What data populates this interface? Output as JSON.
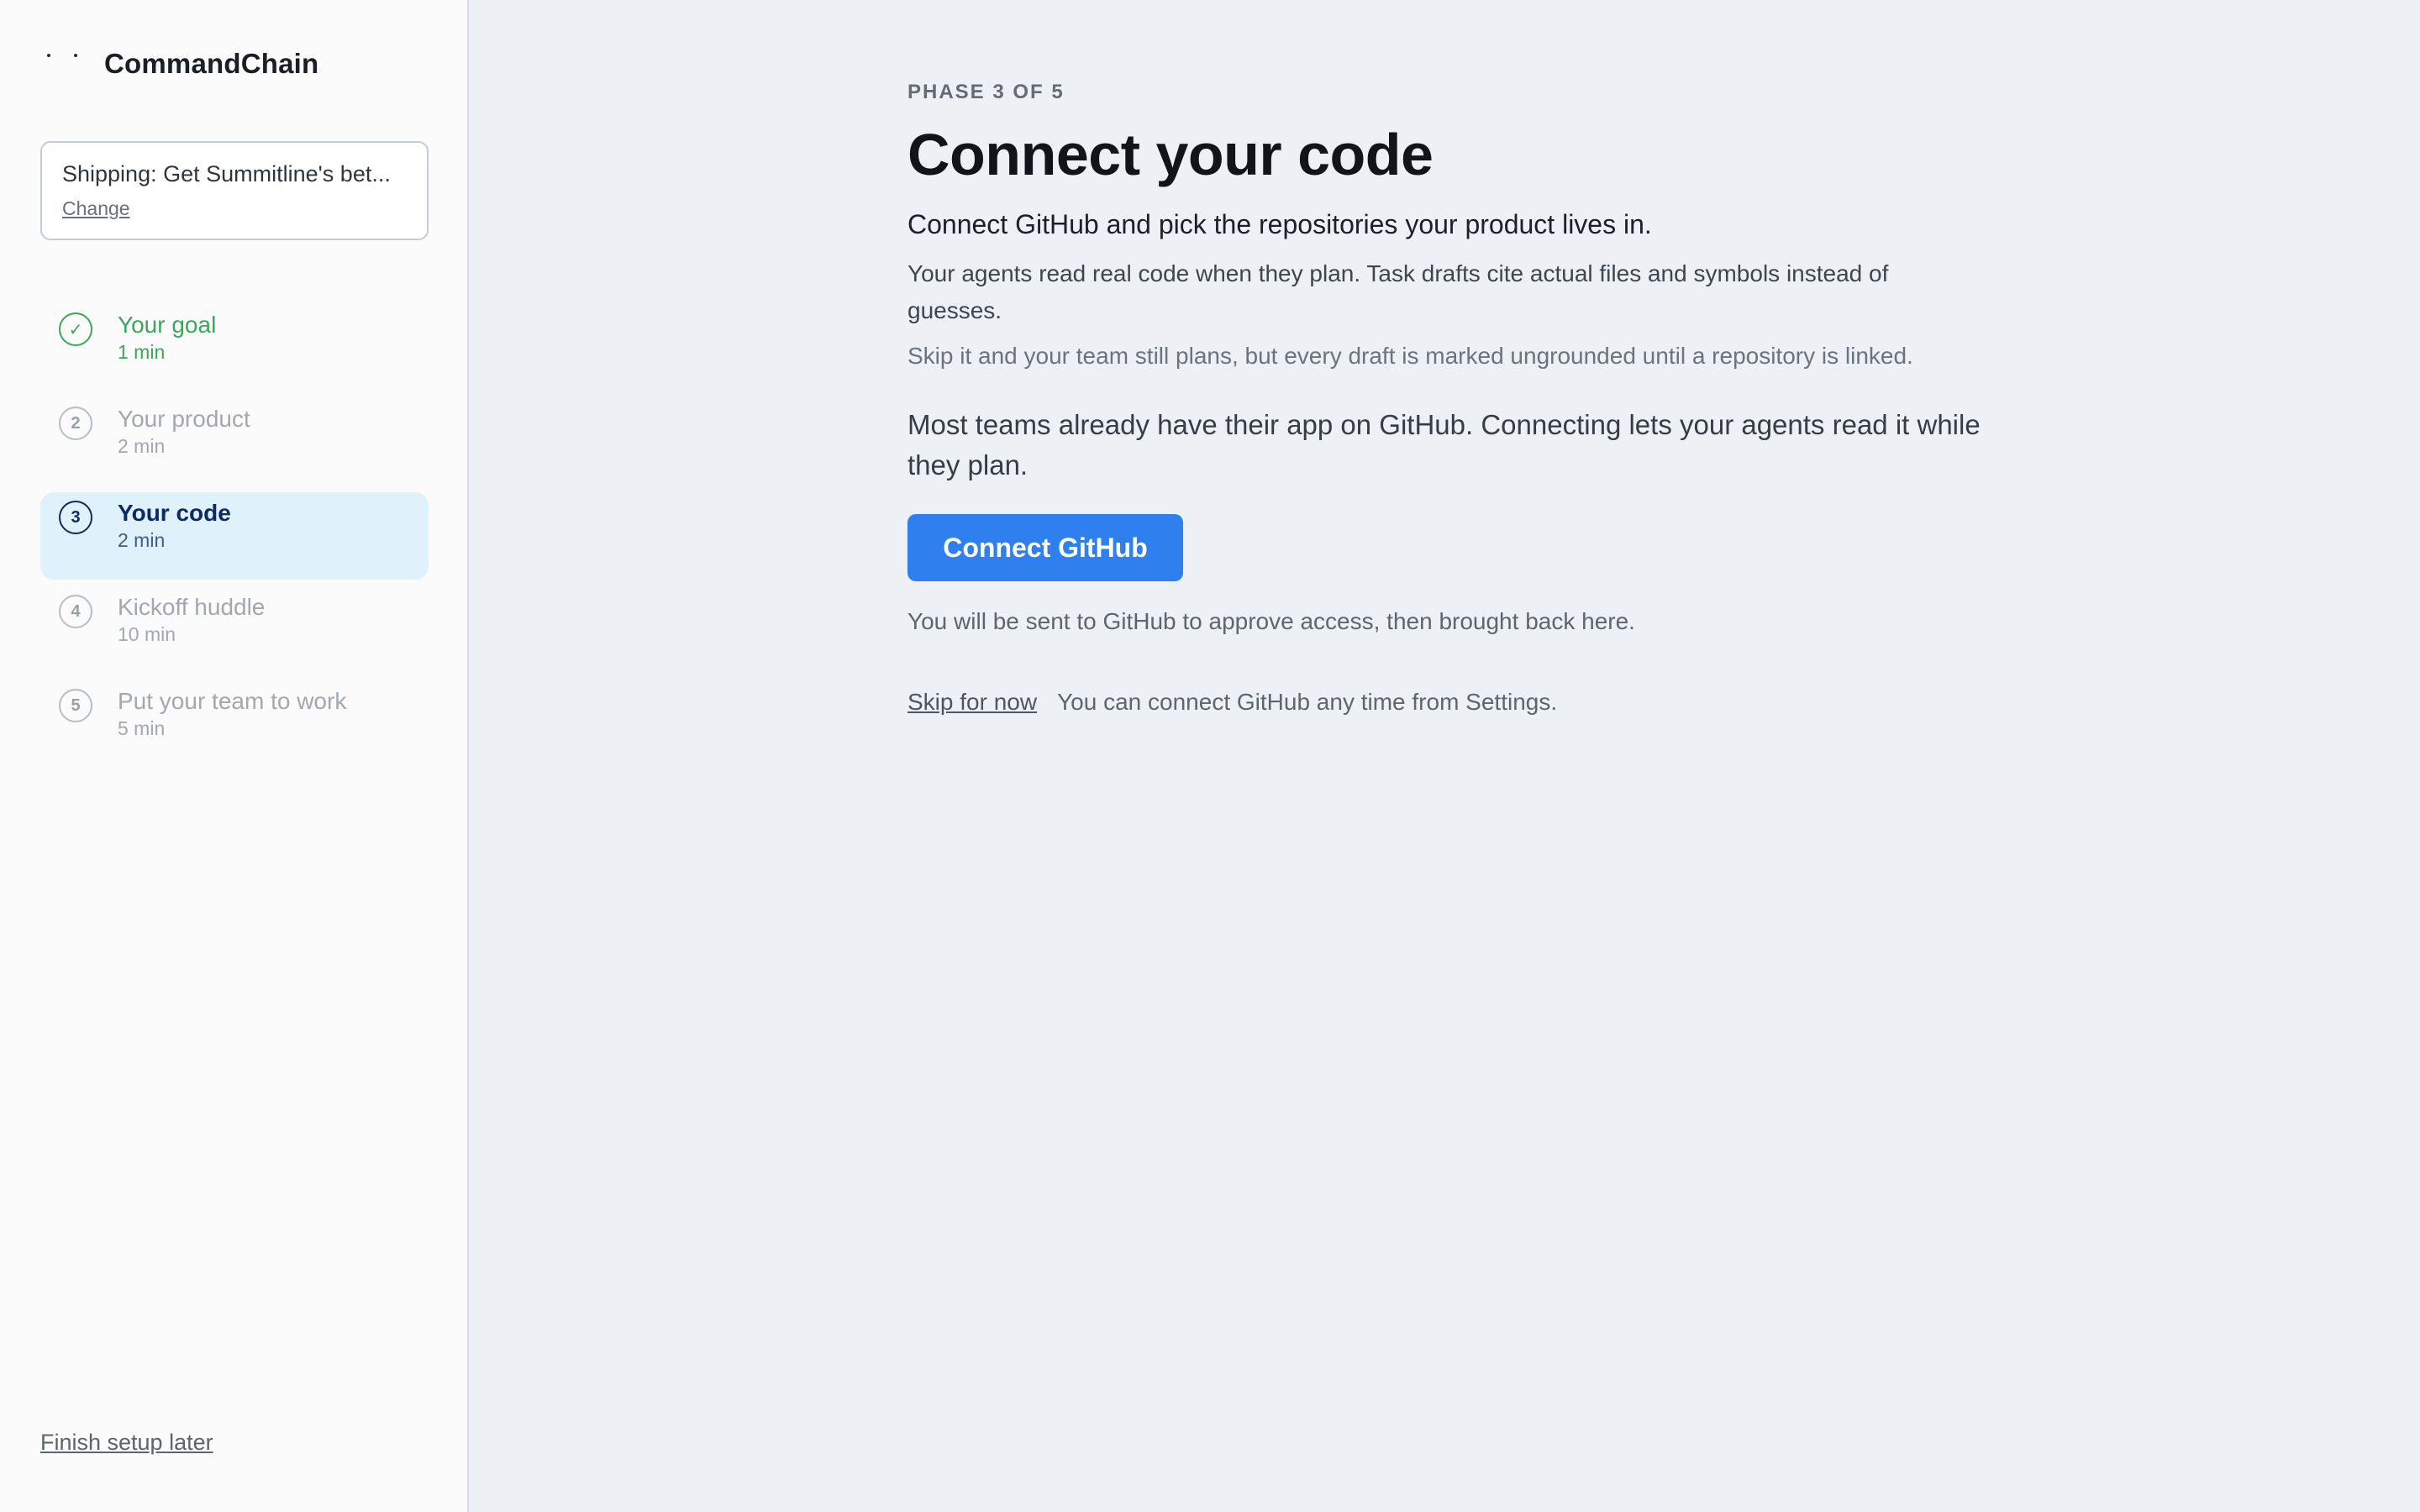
{
  "app": {
    "name": "CommandChain",
    "logo_icon": "commandchain-logo-icon"
  },
  "goal": {
    "text": "Shipping: Get Summitline's bet...",
    "change_label": "Change"
  },
  "steps": [
    {
      "number": "1",
      "label": "Your goal",
      "duration": "1 min",
      "status": "done",
      "icon": "checkmark-icon",
      "glyph": "✓"
    },
    {
      "number": "2",
      "label": "Your product",
      "duration": "2 min",
      "status": "upcoming"
    },
    {
      "number": "3",
      "label": "Your code",
      "duration": "2 min",
      "status": "active"
    },
    {
      "number": "4",
      "label": "Kickoff huddle",
      "duration": "10 min",
      "status": "upcoming"
    },
    {
      "number": "5",
      "label": "Put your team to work",
      "duration": "5 min",
      "status": "upcoming"
    }
  ],
  "sidebar": {
    "finish_later": "Finish setup later"
  },
  "main": {
    "phase": "PHASE 3 OF 5",
    "title": "Connect your code",
    "subtitle": "Connect GitHub and pick the repositories your product lives in.",
    "para1": "Your agents read real code when they plan. Task drafts cite actual files and symbols instead of guesses.",
    "para2": "Skip it and your team still plans, but every draft is marked ungrounded until a repository is linked.",
    "para3": "Most teams already have their app on GitHub. Connecting lets your agents read it while they plan.",
    "connect_button": "Connect GitHub",
    "redirect_note": "You will be sent to GitHub to approve access, then brought back here.",
    "skip_link": "Skip for now",
    "skip_note": "You can connect GitHub any time from Settings."
  },
  "colors": {
    "accent_button": "#2f7fef",
    "done_green": "#3aa75a",
    "active_bg": "#dff1fb",
    "active_text": "#0e2a63",
    "main_bg": "#edf1f6"
  }
}
